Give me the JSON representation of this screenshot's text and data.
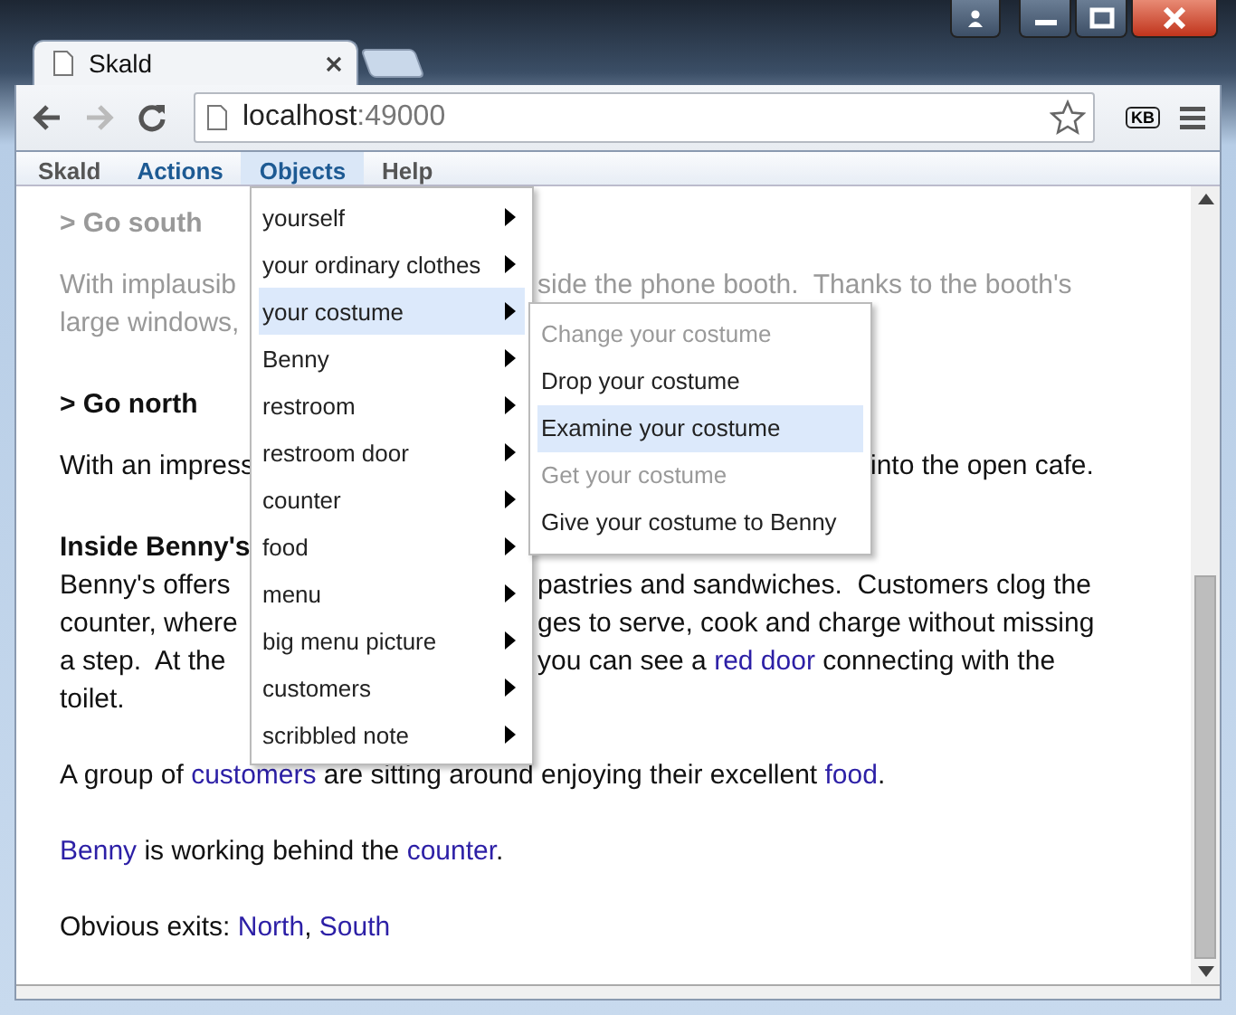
{
  "browser": {
    "tab_title": "Skald",
    "address_host": "localhost",
    "address_port": ":49000",
    "extension_label": "KB"
  },
  "menubar": [
    {
      "label": "Skald",
      "kind": "static",
      "selected": false
    },
    {
      "label": "Actions",
      "kind": "game",
      "selected": false
    },
    {
      "label": "Objects",
      "kind": "game",
      "selected": true
    },
    {
      "label": "Help",
      "kind": "static",
      "selected": false
    }
  ],
  "story": [
    {
      "kind": "heading",
      "dim": true,
      "lines": [
        {
          "left": [
            {
              "kind": "plain",
              "text": "> Go south"
            }
          ]
        }
      ]
    },
    {
      "kind": "text",
      "dim": true,
      "lines": [
        {
          "left": [
            {
              "kind": "plain",
              "text": "With implausib"
            }
          ],
          "covered_by_submenu": false,
          "right": [
            {
              "kind": "plain",
              "text": "side the phone booth.  Thanks to the booth's"
            }
          ]
        },
        {
          "left": [
            {
              "kind": "plain",
              "text": "large windows,"
            }
          ]
        }
      ]
    },
    {
      "kind": "heading",
      "dim": false,
      "lines": [
        {
          "left": [
            {
              "kind": "plain",
              "text": "> Go north"
            }
          ]
        }
      ]
    },
    {
      "kind": "text",
      "dim": false,
      "lines": [
        {
          "left": [
            {
              "kind": "plain",
              "text": "With an impress"
            }
          ],
          "covered_by_submenu": true,
          "right": [
            {
              "kind": "plain",
              "text": "into the open cafe."
            }
          ]
        }
      ]
    },
    {
      "kind": "text",
      "dim": false,
      "lines": [
        {
          "left": [
            {
              "kind": "bold",
              "text": "Inside Benny's"
            }
          ]
        },
        {
          "left": [
            {
              "kind": "plain",
              "text": "Benny's offers"
            }
          ],
          "covered_by_submenu": false,
          "right": [
            {
              "kind": "plain",
              "text": "pastries and sandwiches.  Customers clog the"
            }
          ]
        },
        {
          "left": [
            {
              "kind": "plain",
              "text": "counter, where"
            }
          ],
          "covered_by_submenu": false,
          "right": [
            {
              "kind": "plain",
              "text": "ges to serve, cook and charge without missing"
            }
          ]
        },
        {
          "left": [
            {
              "kind": "plain",
              "text": "a step.  At the"
            }
          ],
          "covered_by_submenu": false,
          "right": [
            {
              "kind": "plain",
              "text": "you can see a "
            },
            {
              "kind": "link",
              "text": "red door"
            },
            {
              "kind": "plain",
              "text": " connecting with the"
            }
          ]
        },
        {
          "left": [
            {
              "kind": "plain",
              "text": "toilet."
            }
          ]
        }
      ]
    },
    {
      "kind": "text",
      "dim": false,
      "lines": [
        {
          "left": [
            {
              "kind": "plain",
              "text": "A group of "
            },
            {
              "kind": "link",
              "text": "customers"
            },
            {
              "kind": "plain",
              "text": " are sitting around enjoying their excellent "
            },
            {
              "kind": "link",
              "text": "food"
            },
            {
              "kind": "plain",
              "text": "."
            }
          ]
        }
      ]
    },
    {
      "kind": "text",
      "dim": false,
      "lines": [
        {
          "left": [
            {
              "kind": "link",
              "text": "Benny"
            },
            {
              "kind": "plain",
              "text": " is working behind the "
            },
            {
              "kind": "link",
              "text": "counter"
            },
            {
              "kind": "plain",
              "text": "."
            }
          ]
        }
      ]
    },
    {
      "kind": "text",
      "dim": false,
      "lines": [
        {
          "left": [
            {
              "kind": "plain",
              "text": "Obvious exits: "
            },
            {
              "kind": "link",
              "text": "North"
            },
            {
              "kind": "plain",
              "text": ", "
            },
            {
              "kind": "link",
              "text": "South"
            }
          ]
        }
      ]
    }
  ],
  "objects_menu": [
    {
      "label": "yourself",
      "selected": false,
      "has_submenu": true
    },
    {
      "label": "your ordinary clothes",
      "selected": false,
      "has_submenu": true
    },
    {
      "label": "your costume",
      "selected": true,
      "has_submenu": true
    },
    {
      "label": "Benny",
      "selected": false,
      "has_submenu": true
    },
    {
      "label": "restroom",
      "selected": false,
      "has_submenu": true
    },
    {
      "label": "restroom door",
      "selected": false,
      "has_submenu": true
    },
    {
      "label": "counter",
      "selected": false,
      "has_submenu": true
    },
    {
      "label": "food",
      "selected": false,
      "has_submenu": true
    },
    {
      "label": "menu",
      "selected": false,
      "has_submenu": true
    },
    {
      "label": "big menu picture",
      "selected": false,
      "has_submenu": true
    },
    {
      "label": "customers",
      "selected": false,
      "has_submenu": true
    },
    {
      "label": "scribbled note",
      "selected": false,
      "has_submenu": true
    }
  ],
  "submenu": [
    {
      "label": "Change your costume",
      "disabled": true,
      "selected": false
    },
    {
      "label": "Drop your costume",
      "disabled": false,
      "selected": false
    },
    {
      "label": "Examine your costume",
      "disabled": false,
      "selected": true
    },
    {
      "label": "Get your costume",
      "disabled": true,
      "selected": false
    },
    {
      "label": "Give your costume to Benny",
      "disabled": false,
      "selected": false
    }
  ]
}
